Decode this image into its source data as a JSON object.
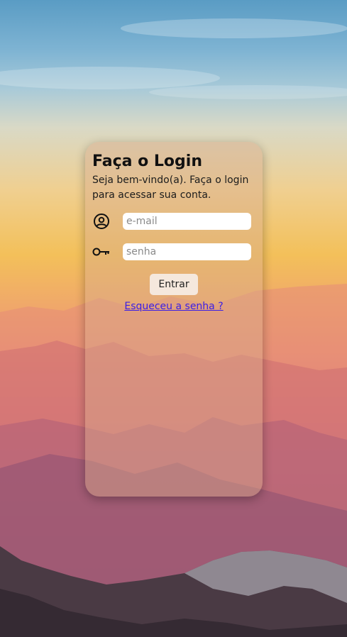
{
  "login": {
    "title": "Faça o Login",
    "subtitle": "Seja bem-vindo(a). Faça o login para acessar sua conta.",
    "email_placeholder": "e-mail",
    "password_placeholder": "senha",
    "submit_label": "Entrar",
    "forgot_label": "Esqueceu a senha ?"
  },
  "icons": {
    "email": "user-circle-icon",
    "password": "key-icon"
  },
  "colors": {
    "link": "#3a1ee6",
    "button_bg": "#f5e8dd",
    "input_bg": "#ffffff"
  }
}
